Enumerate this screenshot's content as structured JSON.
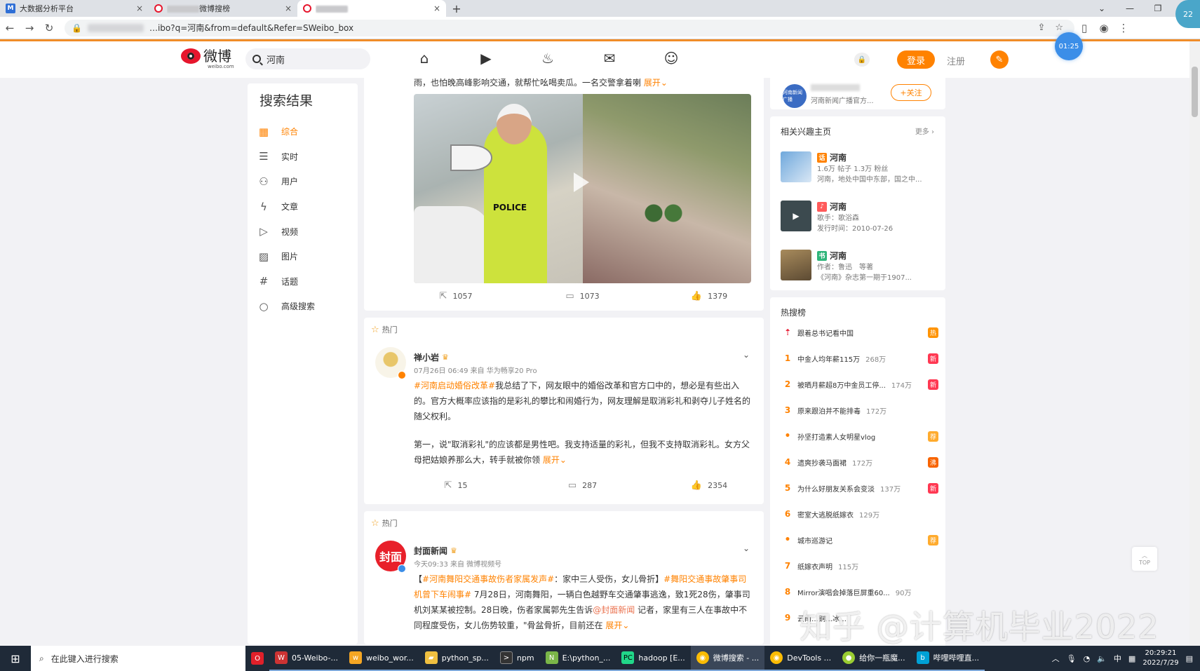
{
  "browser": {
    "tabs": [
      {
        "title": "大数据分析平台",
        "icon": "m-logo-icon"
      },
      {
        "title": "…微博搜索…搜榜",
        "prefix": "",
        "suffix": "微博搜榜",
        "icon": "weibo-icon"
      },
      {
        "title": "",
        "icon": "weibo-icon"
      }
    ],
    "tab2_visible": "搜…搜榜",
    "url": "…ibo?q=河南&from=default&Refer=SWeibo_box",
    "new_tab": "+",
    "close_glyph": "×"
  },
  "weibo": {
    "logo_text": "微博",
    "logo_sub": "weibo.com",
    "search_value": "河南",
    "login_label": "登录",
    "register_label": "注册",
    "timer_badge": "01:25"
  },
  "sidebar": {
    "title": "搜索结果",
    "items": [
      {
        "label": "综合",
        "icon": "grid-icon",
        "active": true
      },
      {
        "label": "实时",
        "icon": "realtime-icon"
      },
      {
        "label": "用户",
        "icon": "user-icon"
      },
      {
        "label": "文章",
        "icon": "article-icon"
      },
      {
        "label": "视频",
        "icon": "video-icon"
      },
      {
        "label": "图片",
        "icon": "image-icon"
      },
      {
        "label": "话题",
        "icon": "topic-icon"
      },
      {
        "label": "高级搜索",
        "icon": "search-icon"
      }
    ]
  },
  "feed": {
    "post1": {
      "text": "雨，也怕晚高峰影响交通，就帮忙吆喝卖瓜。一名交警拿着喇",
      "expand": "展开",
      "image_text": "POLICE",
      "reposts": "1057",
      "comments": "1073",
      "likes": "1379"
    },
    "post2": {
      "hot_label": "热门",
      "author": "禅小岩",
      "meta": "07月26日 06:49 来自 华为畅享20 Pro",
      "tag": "#河南启动婚俗改革#",
      "p1": "我总结了下，网友眼中的婚俗改革和官方口中的，想必是有些出入的。官方大概率应该指的是彩礼的攀比和闹婚行为，网友理解是取消彩礼和剥夺儿子姓名的随父权利。",
      "p2": "第一，说\"取消彩礼\"的应该都是男性吧。我支持适量的彩礼，但我不支持取消彩礼。女方父母把姑娘养那么大，转手就被你领",
      "expand": "展开",
      "reposts": "15",
      "comments": "287",
      "likes": "2354"
    },
    "post3": {
      "hot_label": "热门",
      "author": "封面新闻",
      "avatar_text": "封面",
      "meta": "今天09:33 来自 微博视频号",
      "bracket_open": "【",
      "tag1": "#河南舞阳交通事故伤者家属发声#",
      "t1": "：家中三人受伤，女儿骨折】",
      "tag2": "#舞阳交通事故肇事司机曾下车闹事#",
      "t2": " 7月28日，河南舞阳，一辆白色越野车交通肇事逃逸，致1死28伤，肇事司机刘某某被控制。28日晚，伤者家属郭先生告诉",
      "mention": "@封面新闻",
      "t3": " 记者，家里有三人在事故中不同程度受伤，女儿伤势较重，\"骨盆骨折，目前还在",
      "expand": "展开"
    }
  },
  "right": {
    "follow_card": {
      "desc": "河南新闻广播官方...",
      "follow_label": "+关注",
      "avatar_text": "河南新闻广播"
    },
    "interest": {
      "title": "相关兴趣主页",
      "more": "更多",
      "items": [
        {
          "name": "河南",
          "l1": "1.6万 帖子 1.3万 粉丝",
          "l2": "河南，地处中国中东部，国之中...",
          "badge_color": "#ff8200",
          "badge": "话"
        },
        {
          "name": "河南",
          "l1": "歌手：歌浴森",
          "l2": "发行时间：2010-07-26",
          "badge_color": "#ff5a5a",
          "badge": "♪"
        },
        {
          "name": "河南",
          "l1": "作者：鲁迅　等著",
          "l2": "《河南》杂志第一期于1907...",
          "badge_color": "#2fb57a",
          "badge": "书"
        }
      ]
    },
    "hot": {
      "title": "热搜榜",
      "rows": [
        {
          "rank": "⇡",
          "text": "跟着总书记看中国",
          "num": "",
          "badge": "热",
          "badge_color": "#ff9406",
          "top": true
        },
        {
          "rank": "1",
          "text": "中金人均年薪115万",
          "num": "268万",
          "badge": "新",
          "badge_color": "#ff3852"
        },
        {
          "rank": "2",
          "text": "被晒月薪超8万中金员工停...",
          "num": "174万",
          "badge": "新",
          "badge_color": "#ff3852"
        },
        {
          "rank": "3",
          "text": "原来跟泊并不能排毒",
          "num": "172万",
          "badge": "",
          "badge_color": ""
        },
        {
          "rank": "•",
          "text": "孙坚打造素人女明星vlog",
          "num": "",
          "badge": "荐",
          "badge_color": "#ffab2d",
          "dot": true
        },
        {
          "rank": "4",
          "text": "遗爽抄袭马面裙",
          "num": "172万",
          "badge": "沸",
          "badge_color": "#f86400"
        },
        {
          "rank": "5",
          "text": "为什么好朋友关系会变淡",
          "num": "137万",
          "badge": "新",
          "badge_color": "#ff3852"
        },
        {
          "rank": "6",
          "text": "密室大逃脱纸嫁衣",
          "num": "129万",
          "badge": "",
          "badge_color": ""
        },
        {
          "rank": "•",
          "text": "城市巡游记",
          "num": "",
          "badge": "荐",
          "badge_color": "#ffab2d",
          "dot": true
        },
        {
          "rank": "7",
          "text": "纸嫁衣声明",
          "num": "115万",
          "badge": "",
          "badge_color": ""
        },
        {
          "rank": "8",
          "text": "Mirror演唱会掉落巨屏重60...",
          "num": "90万",
          "badge": "",
          "badge_color": ""
        },
        {
          "rank": "9",
          "text": "云南…铜…冰…",
          "num": "",
          "badge": "",
          "badge_color": ""
        }
      ]
    }
  },
  "misc": {
    "to_top": "TOP",
    "watermark": "知乎 @计算机毕业2022"
  },
  "taskbar": {
    "search_placeholder": "在此键入进行搜索",
    "apps": [
      {
        "label": "",
        "icon": "opera-icon",
        "color": "#e0202a"
      },
      {
        "label": "05-Weibo-...",
        "icon": "app-icon",
        "color": "#c33"
      },
      {
        "label": "weibo_wor...",
        "icon": "weibo-icon",
        "color": "#f5a623"
      },
      {
        "label": "python_sp...",
        "icon": "folder-icon",
        "color": "#f0c040"
      },
      {
        "label": "npm",
        "icon": "terminal-icon",
        "color": "#333"
      },
      {
        "label": "E:\\python_...",
        "icon": "notepad-icon",
        "color": "#7ab648"
      },
      {
        "label": "hadoop [E...",
        "icon": "pycharm-icon",
        "color": "#21d789"
      },
      {
        "label": "微博搜索 - ...",
        "icon": "chrome-icon",
        "color": "#fbbc05"
      },
      {
        "label": "DevTools ...",
        "icon": "chrome-icon",
        "color": "#fbbc05"
      },
      {
        "label": "给你一瓶魔...",
        "icon": "app-icon",
        "color": "#9acd32"
      },
      {
        "label": "哔哩哔哩直...",
        "icon": "bilibili-icon",
        "color": "#00a1d6"
      }
    ],
    "ime": "中",
    "time": "20:29:21",
    "date": "2022/7/29"
  }
}
